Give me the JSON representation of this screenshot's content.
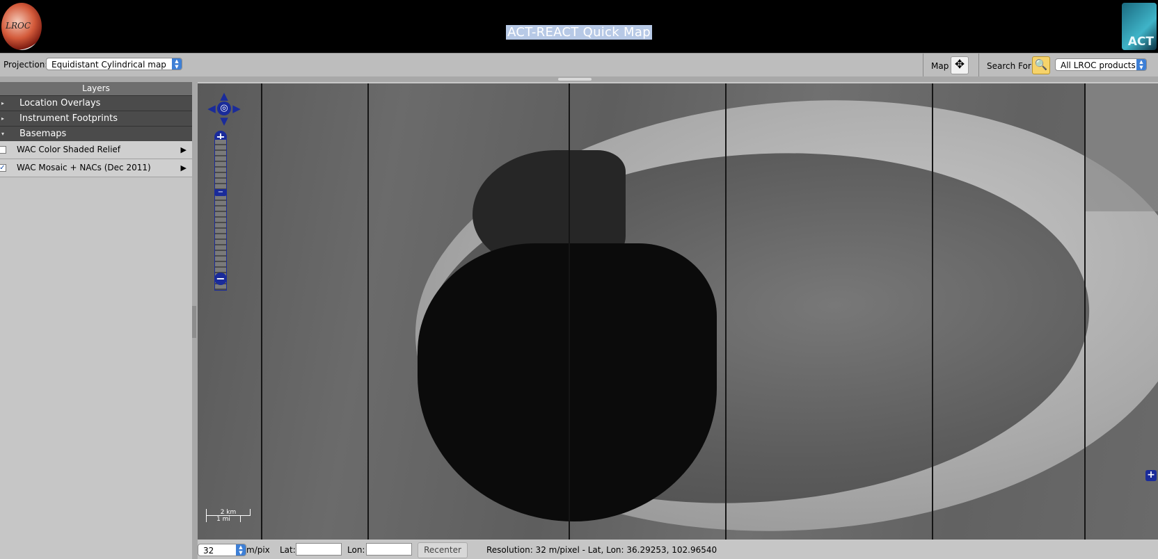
{
  "header": {
    "title": "ACT-REACT Quick Map",
    "left_logo_text": "LROC",
    "right_logo_text": "ACT"
  },
  "toolbar": {
    "projection_label": "Projection:",
    "projection_value": "Equidistant Cylindrical map",
    "map_label": "Map",
    "search_label": "Search For:",
    "products_value": "All LROC products"
  },
  "sidebar": {
    "header": "Layers",
    "sections": [
      {
        "label": "Location Overlays"
      },
      {
        "label": "Instrument Footprints"
      },
      {
        "label": "Basemaps"
      }
    ],
    "basemaps": [
      {
        "label": "WAC Color Shaded Relief",
        "checked": false
      },
      {
        "label": "WAC Mosaic + NACs (Dec 2011)",
        "checked": true
      }
    ]
  },
  "map": {
    "scale_km": "2 km",
    "scale_mi": "1 mi"
  },
  "statusbar": {
    "scale_value": "32",
    "scale_unit": "m/pix",
    "lat_label": "Lat:",
    "lon_label": "Lon:",
    "lat_value": "",
    "lon_value": "",
    "recenter_label": "Recenter",
    "resolution_text": "Resolution: 32 m/pixel - Lat, Lon: 36.29253, 102.96540"
  },
  "colors": {
    "header_bg": "#000000",
    "title_highlight": "#b7c9e6",
    "nav_control": "#1a2b9a",
    "accordion_bg": "#4b4b4b"
  }
}
